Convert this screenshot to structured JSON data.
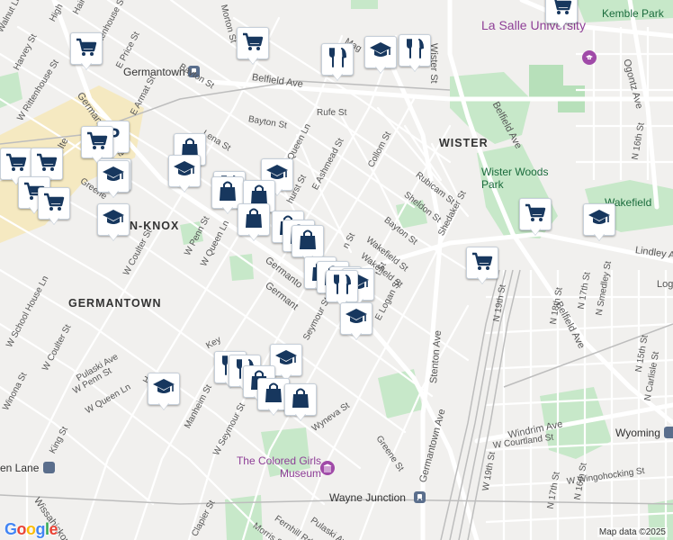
{
  "map": {
    "attribution": "Map data ©2025",
    "logo": "Google",
    "logo_colors": [
      "#4285F4",
      "#EA4335",
      "#FBBC05",
      "#4285F4",
      "#34A853",
      "#EA4335"
    ],
    "colors": {
      "marker_icon": "#17375e",
      "park": "#c7e8c9",
      "highway": "#ffffff",
      "commercial": "#f6e8b8",
      "rail": "#b8b8b8"
    }
  },
  "area_labels": [
    {
      "id": "wister",
      "text": "WISTER"
    },
    {
      "id": "germantown",
      "text": "GERMANTOWN"
    },
    {
      "id": "knox",
      "text": "N-KNOX"
    }
  ],
  "poi_labels": [
    {
      "id": "lasalle",
      "text": "La Salle University",
      "icon": "university-pin-icon"
    },
    {
      "id": "wister-woods",
      "text": "Wister Woods Park"
    },
    {
      "id": "wakefield",
      "text": "Wakefield"
    },
    {
      "id": "kemble",
      "text": "Kemble Park"
    },
    {
      "id": "colored-girls",
      "text": "The Colored Girls Museum",
      "icon": "museum-pin-icon"
    },
    {
      "id": "wayne-junction",
      "text": "Wayne Junction",
      "icon": "train-station-icon"
    },
    {
      "id": "wyoming",
      "text": "Wyoming",
      "icon": "train-station-icon"
    },
    {
      "id": "germantown-station",
      "text": "Germantown",
      "icon": "train-station-icon"
    },
    {
      "id": "queen-lane",
      "text": "en Lane",
      "icon": "train-station-icon"
    }
  ],
  "street_labels": [
    {
      "id": "belfield-ave-top",
      "text": "Belfield Ave"
    },
    {
      "id": "bayton-st-top",
      "text": "Bayton St"
    },
    {
      "id": "bayton-st-mid",
      "text": "Bayton St"
    },
    {
      "id": "bayton-st-right",
      "text": "Bayton St"
    },
    {
      "id": "rufe-st",
      "text": "Rufe St"
    },
    {
      "id": "lena-st",
      "text": "Lena St"
    },
    {
      "id": "e-queen-ln",
      "text": "E Queen Ln"
    },
    {
      "id": "e-ashmead-st",
      "text": "E Ashmead St"
    },
    {
      "id": "collom-st",
      "text": "Collom St"
    },
    {
      "id": "rubicam-st",
      "text": "Rubicam St"
    },
    {
      "id": "sheldon-st",
      "text": "Sheldon St"
    },
    {
      "id": "shedaker-st",
      "text": "Shedaker St"
    },
    {
      "id": "wakefield-st",
      "text": "Wakefield St"
    },
    {
      "id": "e-logan-st",
      "text": "E Logan St"
    },
    {
      "id": "wister-st",
      "text": "Wister St"
    },
    {
      "id": "belfield-ave-right",
      "text": "Belfield Ave"
    },
    {
      "id": "belfield-ave-lower",
      "text": "Belfield Ave"
    },
    {
      "id": "ogontz-ave",
      "text": "Ogontz Ave"
    },
    {
      "id": "n-16th-st-top",
      "text": "N 16th St"
    },
    {
      "id": "lindley-ave",
      "text": "Lindley Ave"
    },
    {
      "id": "n-19th-st",
      "text": "N 19th St"
    },
    {
      "id": "n-18th-st",
      "text": "N 18th St"
    },
    {
      "id": "n-17th-st",
      "text": "N 17th St"
    },
    {
      "id": "n-smedley-st",
      "text": "N Smedley St"
    },
    {
      "id": "n-15th-st",
      "text": "N 15th St"
    },
    {
      "id": "n-carlisle-st",
      "text": "N Carlisle St"
    },
    {
      "id": "windrim-ave",
      "text": "Windrim Ave"
    },
    {
      "id": "w-courtland-st",
      "text": "W Courtland St"
    },
    {
      "id": "w-19th-st",
      "text": "W 19th St"
    },
    {
      "id": "n-17th-st-b",
      "text": "N 17th St"
    },
    {
      "id": "n-16th-st-b",
      "text": "N 16th St"
    },
    {
      "id": "w-wingohocking-st",
      "text": "W Wingohocking St"
    },
    {
      "id": "stenton-ave",
      "text": "Stenton Ave"
    },
    {
      "id": "germantown-ave-lower",
      "text": "Germantown Ave"
    },
    {
      "id": "germantown-ave-mid",
      "text": "Germanto"
    },
    {
      "id": "greene-st",
      "text": "Greene St"
    },
    {
      "id": "wyneva-st",
      "text": "Wyneva St"
    },
    {
      "id": "seymour-st",
      "text": "Seymour St"
    },
    {
      "id": "w-seymour-st",
      "text": "W Seymour St"
    },
    {
      "id": "manheim-st",
      "text": "Manheim St"
    },
    {
      "id": "w-penn-st",
      "text": "W Penn St"
    },
    {
      "id": "w-queen-ln",
      "text": "W Queen Ln"
    },
    {
      "id": "w-coulter-st",
      "text": "W Coulter St"
    },
    {
      "id": "w-coulter-st-b",
      "text": "W Coulter St"
    },
    {
      "id": "pulaski-ave",
      "text": "Pulaski Ave"
    },
    {
      "id": "w-penn-st-b",
      "text": "W Penn St"
    },
    {
      "id": "w-queen-ln-b",
      "text": "W Queen Ln"
    },
    {
      "id": "w-school-house-ln",
      "text": "W School House Ln"
    },
    {
      "id": "winona-st",
      "text": "Winona St"
    },
    {
      "id": "king-st",
      "text": "King St"
    },
    {
      "id": "wissahickon-ave",
      "text": "Wissahickon Ave"
    },
    {
      "id": "clapier-st",
      "text": "Clapier St"
    },
    {
      "id": "morris-st",
      "text": "Morris St"
    },
    {
      "id": "fernhill-rd",
      "text": "Fernhill Rd"
    },
    {
      "id": "pulaski-ave-b",
      "text": "Pulaski Ave"
    },
    {
      "id": "w-rittenhouse-st",
      "text": "W Rittenhouse St"
    },
    {
      "id": "rittenhouse-st",
      "text": "Rittenhouse St"
    },
    {
      "id": "harvey-st",
      "text": "Harvey St"
    },
    {
      "id": "e-price-st",
      "text": "E Price St"
    },
    {
      "id": "e-armat-st",
      "text": "E Armat St"
    },
    {
      "id": "germantown-ave-left",
      "text": "Germantown Ave"
    },
    {
      "id": "w-chelten",
      "text": "W Chelte"
    },
    {
      "id": "greene-st-left",
      "text": "Greene"
    },
    {
      "id": "haines-st",
      "text": "Haines St"
    },
    {
      "id": "walnut-ln",
      "text": "Walnut Ln"
    },
    {
      "id": "morton-st",
      "text": "Morton St"
    },
    {
      "id": "magnolia",
      "text": "Mag"
    },
    {
      "id": "high-st",
      "text": "High"
    },
    {
      "id": "germantown-ave-center",
      "text": "Germant"
    },
    {
      "id": "hurst-st",
      "text": "hurst St"
    },
    {
      "id": "n-st-label",
      "text": "n St"
    },
    {
      "id": "t-st",
      "text": "t St"
    },
    {
      "id": "keyser",
      "text": "Key"
    },
    {
      "id": "wakefield-st-2",
      "text": "Wakefield St"
    },
    {
      "id": "logan-rt",
      "text": "Log"
    },
    {
      "id": "w-hai",
      "text": "H"
    }
  ],
  "markers": [
    {
      "id": "m1",
      "icon": "shopping-cart-icon"
    },
    {
      "id": "m2",
      "icon": "shopping-cart-icon"
    },
    {
      "id": "m3",
      "icon": "shopping-cart-icon"
    },
    {
      "id": "m4",
      "icon": "restaurant-icon"
    },
    {
      "id": "m5",
      "icon": "school-icon"
    },
    {
      "id": "m6",
      "icon": "restaurant-icon"
    },
    {
      "id": "m7",
      "icon": "shopping-cart-icon"
    },
    {
      "id": "m8",
      "icon": "parking-icon"
    },
    {
      "id": "m9",
      "icon": "shopping-cart-icon"
    },
    {
      "id": "m10",
      "icon": "shopping-cart-icon"
    },
    {
      "id": "m11",
      "icon": "shopping-cart-icon"
    },
    {
      "id": "m12",
      "icon": "shopping-cart-icon"
    },
    {
      "id": "m13",
      "icon": "shopping-cart-icon"
    },
    {
      "id": "m14",
      "icon": "school-icon"
    },
    {
      "id": "m15",
      "icon": "school-icon"
    },
    {
      "id": "m16",
      "icon": "shopping-bag-icon"
    },
    {
      "id": "m17",
      "icon": "school-icon"
    },
    {
      "id": "m18",
      "icon": "restaurant-icon"
    },
    {
      "id": "m19",
      "icon": "school-icon"
    },
    {
      "id": "m20",
      "icon": "shopping-bag-icon"
    },
    {
      "id": "m21",
      "icon": "shopping-bag-icon"
    },
    {
      "id": "m22",
      "icon": "shopping-bag-icon"
    },
    {
      "id": "m23",
      "icon": "shopping-bag-icon"
    },
    {
      "id": "m24",
      "icon": "shopping-bag-icon"
    },
    {
      "id": "m25",
      "icon": "shopping-bag-icon"
    },
    {
      "id": "m26",
      "icon": "shopping-bag-icon"
    },
    {
      "id": "m27",
      "icon": "shopping-bag-icon"
    },
    {
      "id": "m28",
      "icon": "restaurant-icon"
    },
    {
      "id": "m29",
      "icon": "school-icon"
    },
    {
      "id": "m30",
      "icon": "restaurant-icon"
    },
    {
      "id": "m31",
      "icon": "shopping-cart-icon"
    },
    {
      "id": "m32",
      "icon": "school-icon"
    },
    {
      "id": "m33",
      "icon": "restaurant-icon"
    },
    {
      "id": "m34",
      "icon": "restaurant-icon"
    },
    {
      "id": "m35",
      "icon": "school-icon"
    },
    {
      "id": "m36",
      "icon": "school-icon"
    },
    {
      "id": "m37",
      "icon": "shopping-bag-icon"
    },
    {
      "id": "m38",
      "icon": "shopping-bag-icon"
    },
    {
      "id": "m39",
      "icon": "shopping-bag-icon"
    },
    {
      "id": "m40",
      "icon": "school-icon"
    },
    {
      "id": "m41",
      "icon": "shopping-cart-icon"
    }
  ]
}
